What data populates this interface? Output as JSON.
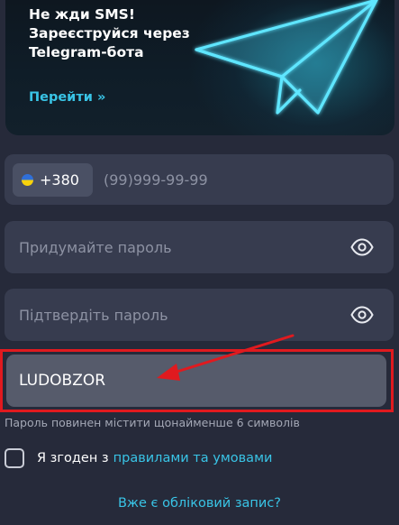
{
  "banner": {
    "title_lines": [
      "Не жди SMS!",
      "Зареєструйся через",
      "Telegram-бота"
    ],
    "link": "Перейти »",
    "icon": "telegram-paper-plane-icon"
  },
  "phone": {
    "flag_icon": "ukraine-flag-icon",
    "country_code": "+380",
    "placeholder": "(99)999-99-99"
  },
  "password": {
    "placeholder": "Придумайте пароль",
    "icon": "eye-icon"
  },
  "confirm_password": {
    "placeholder": "Підтвердіть пароль",
    "icon": "eye-icon"
  },
  "promo": {
    "value": "LUDOBZOR",
    "highlight_color": "#e01a1f"
  },
  "password_hint": "Пароль повинен містити щонайменше 6 символів",
  "agreement": {
    "text": "Я згоден з",
    "link": "правилами та умовами"
  },
  "login_link": "Вже є обліковий запис?",
  "colors": {
    "background": "#262a3a",
    "field": "#373c4f",
    "accent": "#39c4e6"
  }
}
